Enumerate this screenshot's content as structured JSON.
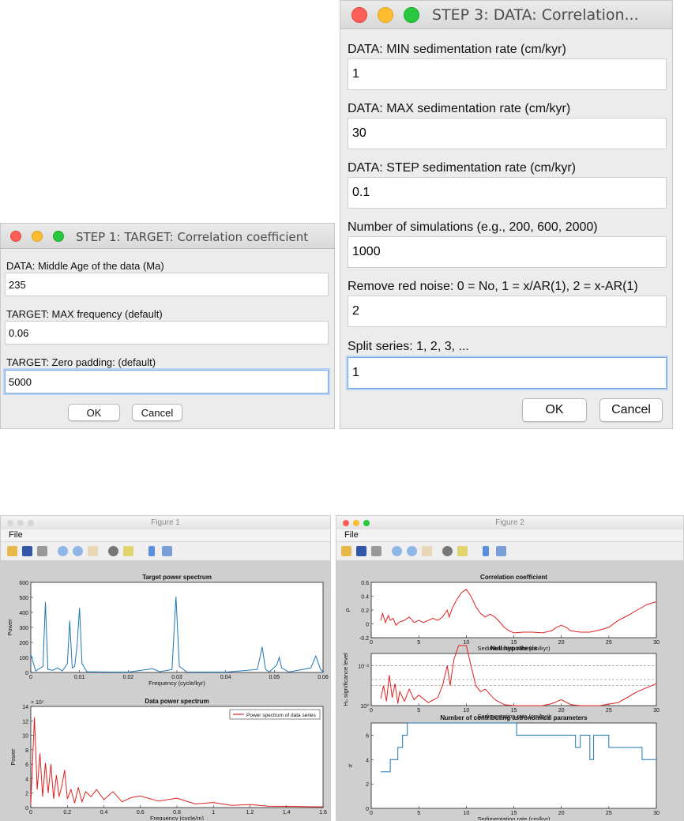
{
  "dialog_step1": {
    "title": "STEP 1: TARGET: Correlation coefficient",
    "fields": [
      {
        "label": "DATA: Middle Age of the data (Ma)",
        "value": "235"
      },
      {
        "label": "TARGET: MAX frequency (default)",
        "value": "0.06"
      },
      {
        "label": "TARGET: Zero padding: (default)",
        "value": "5000"
      }
    ],
    "ok_label": "OK",
    "cancel_label": "Cancel"
  },
  "dialog_step3": {
    "title": "STEP 3: DATA: Correlation...",
    "fields": [
      {
        "label": "DATA: MIN  sedimentation rate (cm/kyr)",
        "value": "1"
      },
      {
        "label": "DATA: MAX  sedimentation rate (cm/kyr)",
        "value": "30"
      },
      {
        "label": "DATA: STEP sedimentation rate (cm/kyr)",
        "value": "0.1"
      },
      {
        "label": "Number of simulations (e.g., 200, 600, 2000)",
        "value": "1000"
      },
      {
        "label": "Remove red noise: 0 = No, 1 = x/AR(1), 2 = x-AR(1)",
        "value": "2"
      },
      {
        "label": "Split series: 1, 2, 3, ...",
        "value": "1"
      }
    ],
    "ok_label": "OK",
    "cancel_label": "Cancel"
  },
  "figure1": {
    "window_title": "Figure 1",
    "menu_file": "File",
    "tools": [
      "open-icon",
      "save-icon",
      "print-icon",
      "zoom-in-icon",
      "zoom-out-icon",
      "pan-icon",
      "rotate-icon",
      "data-cursor-icon",
      "colorbar-icon",
      "legend-icon"
    ]
  },
  "figure2": {
    "window_title": "Figure 2",
    "menu_file": "File",
    "tools": [
      "open-icon",
      "save-icon",
      "print-icon",
      "zoom-in-icon",
      "zoom-out-icon",
      "pan-icon",
      "rotate-icon",
      "data-cursor-icon",
      "colorbar-icon",
      "legend-icon"
    ]
  },
  "colors": {
    "blue_line": "#1f77b4",
    "red_line": "#e02020",
    "blue_steps": "#2020d0"
  },
  "chart_data": [
    {
      "type": "line",
      "title": "Target power spectrum",
      "xlabel": "Frequency (cycle/kyr)",
      "ylabel": "Power",
      "xlim": [
        0,
        0.06
      ],
      "ylim": [
        0,
        600
      ],
      "xticks": [
        "0",
        "0.01",
        "0.02",
        "0.03",
        "0.04",
        "0.05",
        "0.06"
      ],
      "yticks": [
        "0",
        "100",
        "200",
        "300",
        "400",
        "500",
        "600"
      ],
      "series": [
        {
          "color": "blue",
          "points": [
            [
              0,
              120
            ],
            [
              0.001,
              10
            ],
            [
              0.0025,
              40
            ],
            [
              0.003,
              470
            ],
            [
              0.0035,
              20
            ],
            [
              0.0045,
              15
            ],
            [
              0.0055,
              30
            ],
            [
              0.0065,
              10
            ],
            [
              0.0075,
              60
            ],
            [
              0.008,
              345
            ],
            [
              0.0085,
              30
            ],
            [
              0.009,
              40
            ],
            [
              0.0095,
              180
            ],
            [
              0.01,
              430
            ],
            [
              0.0105,
              60
            ],
            [
              0.0115,
              5
            ],
            [
              0.015,
              3
            ],
            [
              0.02,
              2
            ],
            [
              0.025,
              25
            ],
            [
              0.0265,
              5
            ],
            [
              0.029,
              20
            ],
            [
              0.0298,
              505
            ],
            [
              0.0305,
              40
            ],
            [
              0.032,
              3
            ],
            [
              0.04,
              2
            ],
            [
              0.0465,
              20
            ],
            [
              0.0475,
              170
            ],
            [
              0.0482,
              20
            ],
            [
              0.049,
              3
            ],
            [
              0.0505,
              50
            ],
            [
              0.051,
              100
            ],
            [
              0.0515,
              30
            ],
            [
              0.053,
              3
            ],
            [
              0.0575,
              30
            ],
            [
              0.0585,
              110
            ],
            [
              0.0595,
              20
            ],
            [
              0.06,
              5
            ]
          ]
        }
      ]
    },
    {
      "type": "line",
      "title": "Data power spectrum",
      "xlabel": "Frequency (cycle/m)",
      "ylabel": "Power",
      "xlim": [
        0,
        1.6
      ],
      "ylim": [
        0,
        14
      ],
      "exponent_label": "× 10⁵",
      "xticks": [
        "0",
        "0.2",
        "0.4",
        "0.6",
        "0.8",
        "1",
        "1.2",
        "1.4",
        "1.6"
      ],
      "yticks": [
        "0",
        "2",
        "4",
        "6",
        "8",
        "10",
        "12",
        "14"
      ],
      "legend": "Power spectrum of data series",
      "series": [
        {
          "color": "red",
          "points": [
            [
              0,
              0.5
            ],
            [
              0.02,
              12.5
            ],
            [
              0.035,
              2.5
            ],
            [
              0.05,
              7.5
            ],
            [
              0.065,
              1.5
            ],
            [
              0.08,
              6.2
            ],
            [
              0.095,
              2
            ],
            [
              0.11,
              6
            ],
            [
              0.125,
              1.2
            ],
            [
              0.14,
              4.5
            ],
            [
              0.155,
              1.5
            ],
            [
              0.17,
              3
            ],
            [
              0.185,
              5.2
            ],
            [
              0.2,
              1.2
            ],
            [
              0.22,
              2.5
            ],
            [
              0.24,
              0.6
            ],
            [
              0.26,
              2.8
            ],
            [
              0.28,
              0.8
            ],
            [
              0.3,
              2.2
            ],
            [
              0.33,
              1.5
            ],
            [
              0.36,
              2.5
            ],
            [
              0.4,
              1.1
            ],
            [
              0.45,
              2.2
            ],
            [
              0.5,
              0.8
            ],
            [
              0.55,
              1.4
            ],
            [
              0.6,
              1.6
            ],
            [
              0.7,
              0.9
            ],
            [
              0.8,
              1.3
            ],
            [
              0.9,
              0.5
            ],
            [
              1.0,
              0.7
            ],
            [
              1.1,
              0.3
            ],
            [
              1.2,
              0.4
            ],
            [
              1.3,
              0.2
            ],
            [
              1.45,
              0.15
            ],
            [
              1.6,
              0.1
            ]
          ]
        }
      ]
    },
    {
      "type": "line",
      "title": "Correlation coefficient",
      "xlabel": "Sedimentation rate (cm/kyr)",
      "ylabel": "ρ",
      "xlim": [
        0,
        30
      ],
      "ylim": [
        -0.2,
        0.6
      ],
      "xticks": [
        "0",
        "5",
        "10",
        "15",
        "20",
        "25",
        "30"
      ],
      "yticks": [
        "-0.2",
        "0",
        "0.2",
        "0.4",
        "0.6"
      ],
      "series": [
        {
          "color": "red",
          "points": [
            [
              1,
              0.05
            ],
            [
              1.2,
              0.15
            ],
            [
              1.5,
              0.02
            ],
            [
              1.8,
              0.12
            ],
            [
              2,
              0.05
            ],
            [
              2.3,
              0.08
            ],
            [
              2.6,
              -0.02
            ],
            [
              3,
              0.03
            ],
            [
              3.5,
              0.05
            ],
            [
              4,
              0.1
            ],
            [
              4.5,
              0.02
            ],
            [
              5,
              0.05
            ],
            [
              5.5,
              0.02
            ],
            [
              6,
              0.05
            ],
            [
              6.5,
              0.08
            ],
            [
              7,
              0.05
            ],
            [
              7.5,
              0.1
            ],
            [
              8,
              0.2
            ],
            [
              8.2,
              0.1
            ],
            [
              8.5,
              0.22
            ],
            [
              9,
              0.35
            ],
            [
              9.5,
              0.45
            ],
            [
              10,
              0.5
            ],
            [
              10.5,
              0.4
            ],
            [
              11,
              0.25
            ],
            [
              11.5,
              0.15
            ],
            [
              12,
              0.1
            ],
            [
              12.5,
              0.14
            ],
            [
              13,
              0.1
            ],
            [
              13.5,
              0.03
            ],
            [
              14,
              -0.05
            ],
            [
              14.5,
              -0.1
            ],
            [
              15,
              -0.13
            ],
            [
              16,
              -0.12
            ],
            [
              17,
              -0.12
            ],
            [
              18,
              -0.13
            ],
            [
              19,
              -0.1
            ],
            [
              19.5,
              -0.05
            ],
            [
              20,
              -0.02
            ],
            [
              20.5,
              -0.05
            ],
            [
              21,
              -0.1
            ],
            [
              22,
              -0.12
            ],
            [
              23,
              -0.12
            ],
            [
              24,
              -0.09
            ],
            [
              25,
              -0.05
            ],
            [
              26,
              0.05
            ],
            [
              27,
              0.12
            ],
            [
              28,
              0.2
            ],
            [
              29,
              0.28
            ],
            [
              30,
              0.32
            ]
          ]
        }
      ]
    },
    {
      "type": "line",
      "title": "Null hypothesis",
      "xlabel": "Sedimentation rate (cm/kyr)",
      "ylabel": "H₀ significance level",
      "xlim": [
        0,
        30
      ],
      "yscale": "log",
      "xticks": [
        "0",
        "5",
        "10",
        "15",
        "20",
        "25",
        "30"
      ],
      "yticks": [
        "10⁻²",
        "10⁰"
      ],
      "series": [
        {
          "color": "red",
          "points": [
            [
              1,
              0.45
            ],
            [
              1.3,
              0.1
            ],
            [
              1.6,
              0.6
            ],
            [
              1.9,
              0.03
            ],
            [
              2.2,
              0.4
            ],
            [
              2.5,
              0.08
            ],
            [
              2.8,
              0.8
            ],
            [
              3,
              0.2
            ],
            [
              3.5,
              0.6
            ],
            [
              4,
              0.15
            ],
            [
              4.5,
              0.5
            ],
            [
              5,
              0.3
            ],
            [
              6,
              0.7
            ],
            [
              7,
              0.4
            ],
            [
              7.5,
              0.1
            ],
            [
              8,
              0.01
            ],
            [
              8.3,
              0.1
            ],
            [
              8.7,
              0.005
            ],
            [
              9.2,
              0.001
            ],
            [
              10,
              0.001
            ],
            [
              10.5,
              0.01
            ],
            [
              11,
              0.1
            ],
            [
              11.5,
              0.2
            ],
            [
              12,
              0.15
            ],
            [
              13,
              0.5
            ],
            [
              14,
              0.9
            ],
            [
              15,
              1
            ],
            [
              18,
              1
            ],
            [
              19,
              0.8
            ],
            [
              20,
              0.5
            ],
            [
              21,
              0.9
            ],
            [
              22,
              1
            ],
            [
              24,
              1
            ],
            [
              26,
              0.7
            ],
            [
              28,
              0.2
            ],
            [
              30,
              0.08
            ]
          ]
        }
      ]
    },
    {
      "type": "line",
      "title": "Number of contributing astronomical parameters",
      "xlabel": "Sedimentation rate (cm/kyr)",
      "ylabel": "#",
      "xlim": [
        0,
        30
      ],
      "ylim": [
        0,
        7
      ],
      "xticks": [
        "0",
        "5",
        "10",
        "15",
        "20",
        "25",
        "30"
      ],
      "yticks": [
        "0",
        "2",
        "4",
        "6"
      ],
      "series": [
        {
          "color": "blue",
          "points": [
            [
              1,
              3
            ],
            [
              2,
              3
            ],
            [
              2,
              4
            ],
            [
              2.8,
              4
            ],
            [
              2.8,
              5
            ],
            [
              3.3,
              5
            ],
            [
              3.3,
              6
            ],
            [
              3.8,
              6
            ],
            [
              3.8,
              7
            ],
            [
              15.3,
              7
            ],
            [
              15.3,
              6
            ],
            [
              21.5,
              6
            ],
            [
              21.5,
              5
            ],
            [
              22,
              5
            ],
            [
              22,
              6
            ],
            [
              23,
              6
            ],
            [
              23,
              4
            ],
            [
              23.4,
              4
            ],
            [
              23.4,
              6
            ],
            [
              25,
              6
            ],
            [
              25,
              5
            ],
            [
              27,
              5
            ],
            [
              27,
              5
            ],
            [
              28.5,
              5
            ],
            [
              28.5,
              4
            ],
            [
              30,
              4
            ]
          ]
        }
      ]
    }
  ]
}
